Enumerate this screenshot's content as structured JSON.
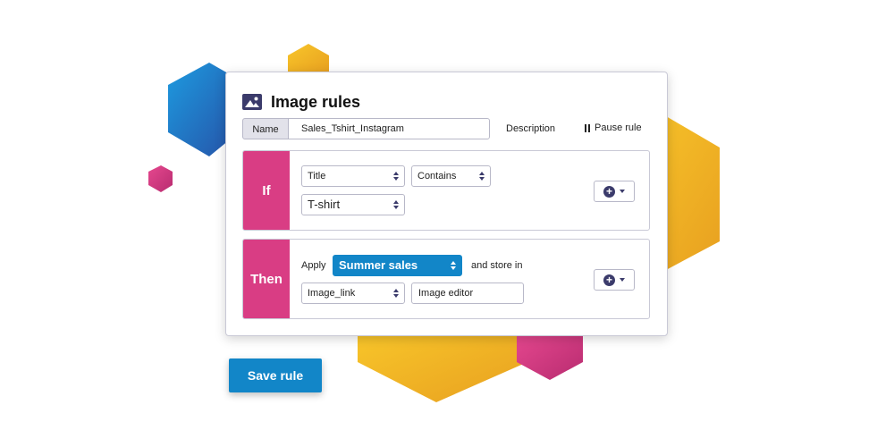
{
  "colors": {
    "accent_blue": "#1286c8",
    "accent_pink": "#d93d84",
    "hex_yellow": "#f3bd24",
    "hex_blue": "#1a8fd6",
    "dark_icon": "#3b3b6b"
  },
  "card": {
    "title": "Image rules",
    "title_icon": "image-icon",
    "name_label": "Name",
    "name_value": "Sales_Tshirt_Instagram",
    "description_label": "Description",
    "pause_label": "Pause rule"
  },
  "if_section": {
    "label": "If",
    "field_select": "Title",
    "operator_select": "Contains",
    "value_select": "T-shirt"
  },
  "then_section": {
    "label": "Then",
    "apply_text": "Apply",
    "template_select": "Summer sales",
    "store_text": "and store in",
    "target_select": "Image_link",
    "editor_input": "Image editor"
  },
  "footer": {
    "save_label": "Save rule"
  }
}
